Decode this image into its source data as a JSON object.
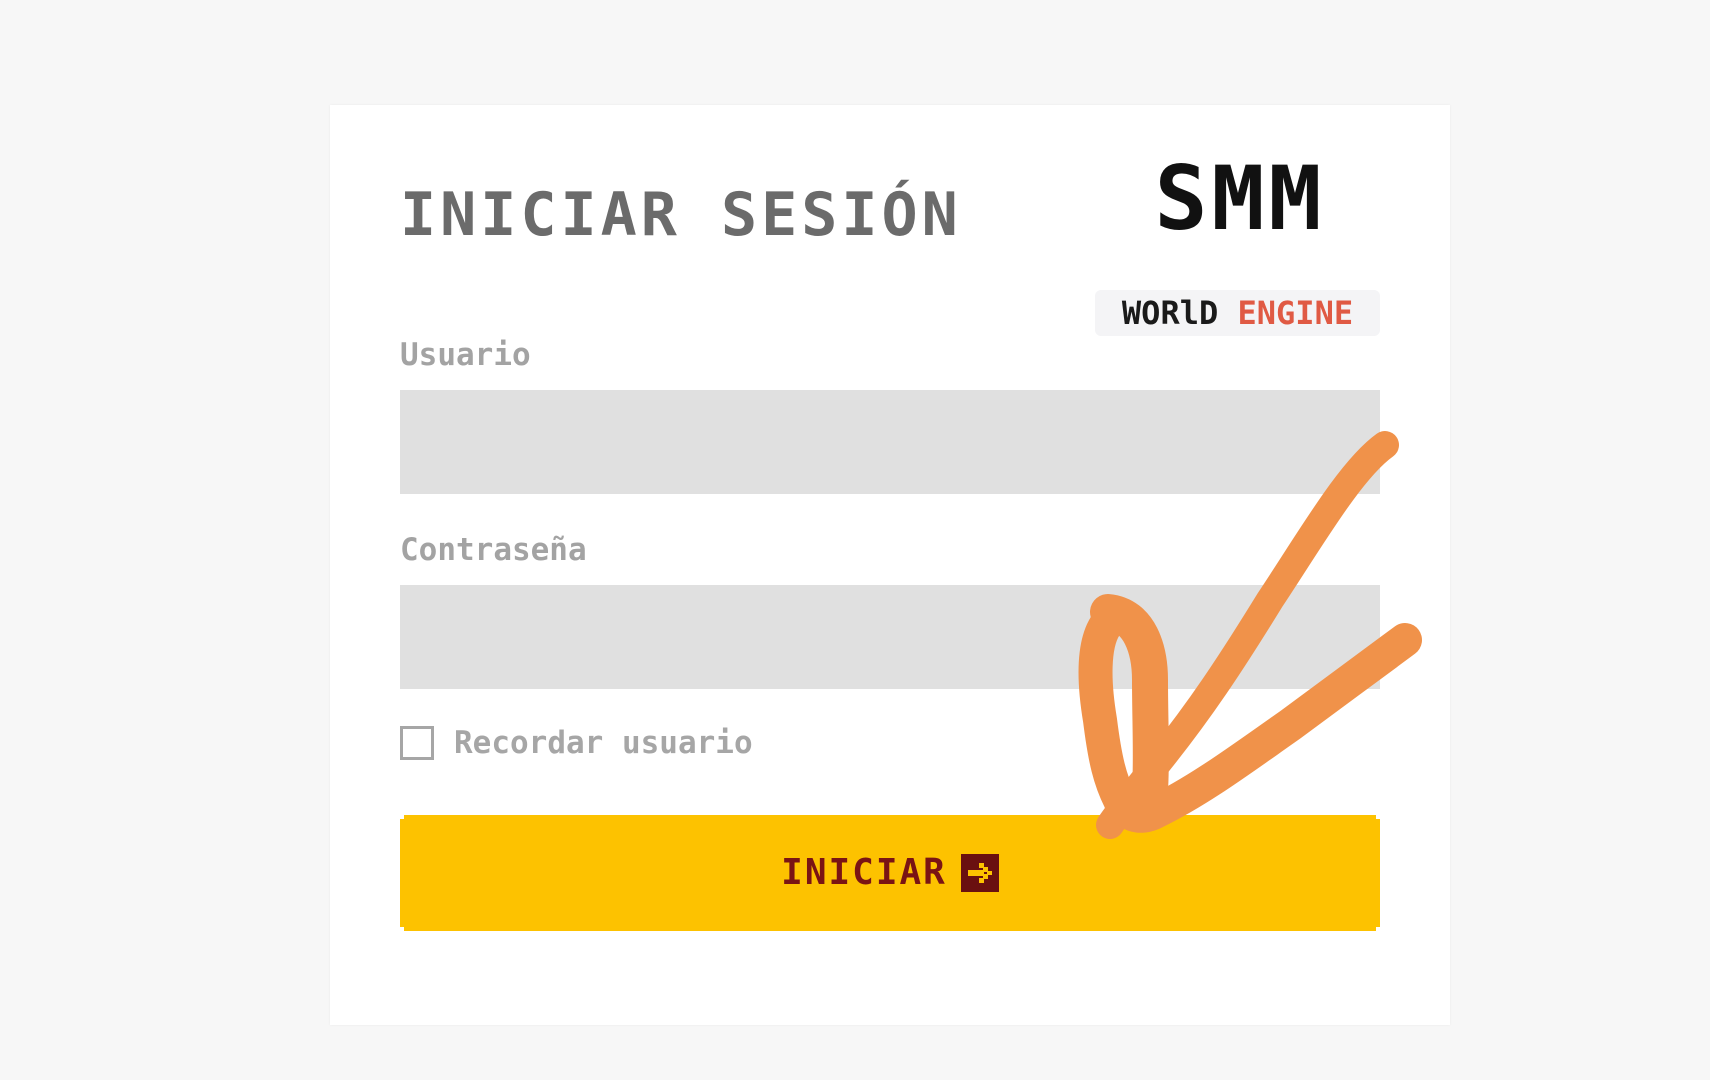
{
  "login": {
    "title": "INICIAR SESIÓN",
    "username_label": "Usuario",
    "username_value": "",
    "password_label": "Contraseña",
    "password_value": "",
    "remember_label": "Recordar usuario",
    "remember_checked": false,
    "submit_label": "INICIAR",
    "submit_icon": "arrow-right-box-icon"
  },
  "logo": {
    "main": "SMM",
    "sub_word1": "WORlD",
    "sub_word2": "ENGINE"
  },
  "colors": {
    "page_bg": "#f7f7f7",
    "card_bg": "#ffffff",
    "title": "#6b6b6b",
    "input_bg": "#e0e0e0",
    "button_bg": "#fdc200",
    "button_text": "#7a1414",
    "logo_accent": "#e05a44",
    "annotation_stroke": "#f0924a"
  },
  "annotation": {
    "icon": "checkmark-arrow-icon"
  }
}
